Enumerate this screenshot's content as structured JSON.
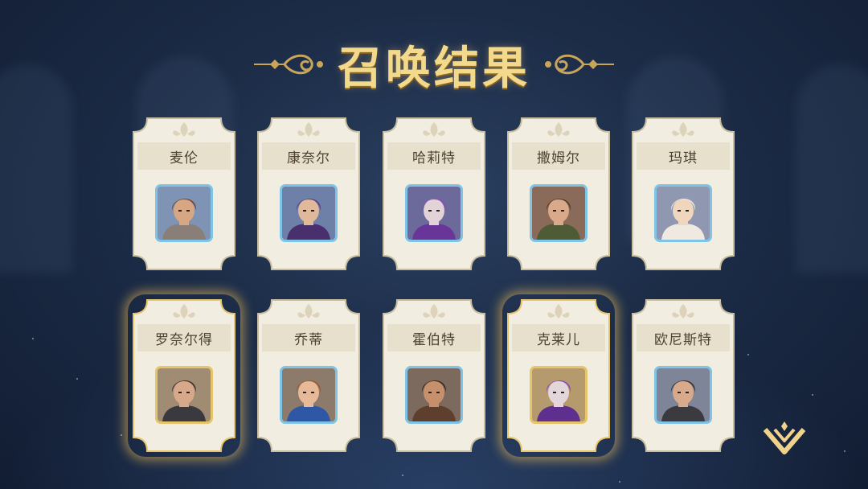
{
  "header": {
    "title": "召唤结果"
  },
  "colors": {
    "card_fill": "#f1ede0",
    "card_band": "#e7e0cc",
    "card_border": "#c9bd9f",
    "gold": "#f3d98c",
    "portrait_border_blue": "#7fc3e6",
    "portrait_border_gold": "#e6c46a"
  },
  "results": [
    {
      "name": "麦伦",
      "rarity": "normal",
      "portrait": {
        "bg": "#7f93b5",
        "skin": "#d7a683",
        "hair": "#6b4b35",
        "cloth": "#8a7f78"
      }
    },
    {
      "name": "康奈尔",
      "rarity": "normal",
      "portrait": {
        "bg": "#6e7fa8",
        "skin": "#e0b89a",
        "hair": "#5b3e86",
        "cloth": "#4a2f6e"
      }
    },
    {
      "name": "哈莉特",
      "rarity": "normal",
      "portrait": {
        "bg": "#6c6a9a",
        "skin": "#e2d3d8",
        "hair": "#8b4cc0",
        "cloth": "#6a3598"
      }
    },
    {
      "name": "撒姆尔",
      "rarity": "normal",
      "portrait": {
        "bg": "#8a6a58",
        "skin": "#d9a98a",
        "hair": "#5a3b27",
        "cloth": "#4f5a36"
      }
    },
    {
      "name": "玛琪",
      "rarity": "normal",
      "portrait": {
        "bg": "#8f98b0",
        "skin": "#f0d6bd",
        "hair": "#e8e4df",
        "cloth": "#efe9e2"
      }
    },
    {
      "name": "罗奈尔得",
      "rarity": "rare",
      "portrait": {
        "bg": "#a08c72",
        "skin": "#d7a98a",
        "hair": "#3d3636",
        "cloth": "#3a3a3e"
      }
    },
    {
      "name": "乔蒂",
      "rarity": "normal",
      "portrait": {
        "bg": "#8c7a6a",
        "skin": "#e6b999",
        "hair": "#9a5a34",
        "cloth": "#2e58a6"
      }
    },
    {
      "name": "霍伯特",
      "rarity": "normal",
      "portrait": {
        "bg": "#7c6a5e",
        "skin": "#c7906c",
        "hair": "#3c2b22",
        "cloth": "#5e3f2e"
      }
    },
    {
      "name": "克莱儿",
      "rarity": "rare",
      "portrait": {
        "bg": "#b59a6e",
        "skin": "#e3d6db",
        "hair": "#8b4cc0",
        "cloth": "#5e2f8e"
      }
    },
    {
      "name": "欧尼斯特",
      "rarity": "normal",
      "portrait": {
        "bg": "#7e8598",
        "skin": "#d8a98b",
        "hair": "#3d3434",
        "cloth": "#3b3a3f"
      }
    }
  ],
  "controls": {
    "next_icon": "chevron-down-icon"
  }
}
